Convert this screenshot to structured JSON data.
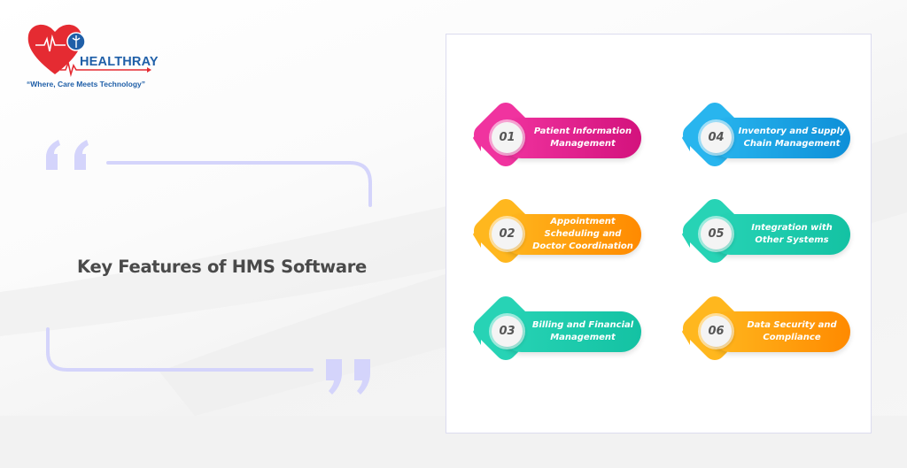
{
  "brand": {
    "name": "HEALTHRAY",
    "tagline": "“Where, Care Meets Technology”",
    "colors": {
      "heart": "#e52b32",
      "text": "#1f5fa8"
    }
  },
  "title": "Key Features of HMS Software",
  "features": [
    {
      "number": "01",
      "label": "Patient Information Management",
      "color_start": "#f0339f",
      "color_end": "#d3127d"
    },
    {
      "number": "02",
      "label": "Appointment Scheduling and Doctor Coordination",
      "color_start": "#ffb71e",
      "color_end": "#ff8a00"
    },
    {
      "number": "03",
      "label": "Billing and Financial Management",
      "color_start": "#27d3b5",
      "color_end": "#14c2a3"
    },
    {
      "number": "04",
      "label": "Inventory and Supply Chain Management",
      "color_start": "#28b5ee",
      "color_end": "#0e8fd8"
    },
    {
      "number": "05",
      "label": "Integration with Other Systems",
      "color_start": "#27d3b5",
      "color_end": "#14c2a3"
    },
    {
      "number": "06",
      "label": "Data Security and Compliance",
      "color_start": "#ffb71e",
      "color_end": "#ff8a00"
    }
  ],
  "accent": "#d4d4fb"
}
